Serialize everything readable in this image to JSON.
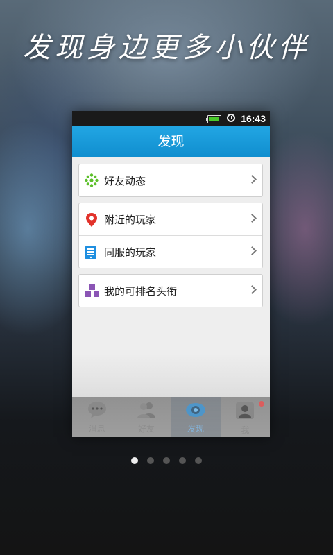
{
  "headline": "发现身边更多小伙伴",
  "status_bar": {
    "time": "16:43"
  },
  "title": "发现",
  "menu": {
    "group1": [
      {
        "label": "好友动态",
        "icon": "friends-activity-icon",
        "icon_color": "#5cbf2a"
      }
    ],
    "group2": [
      {
        "label": "附近的玩家",
        "icon": "location-pin-icon",
        "icon_color": "#e2322b"
      },
      {
        "label": "同服的玩家",
        "icon": "server-icon",
        "icon_color": "#1f8fe0"
      }
    ],
    "group3": [
      {
        "label": "我的可排名头衔",
        "icon": "rank-blocks-icon",
        "icon_color": "#8b55b5"
      }
    ]
  },
  "tabbar": {
    "tabs": [
      {
        "label": "消息",
        "icon": "chat-bubble-icon"
      },
      {
        "label": "好友",
        "icon": "contacts-icon"
      },
      {
        "label": "发现",
        "icon": "discover-eye-icon",
        "active": true
      },
      {
        "label": "我",
        "icon": "profile-icon",
        "badge": true
      }
    ]
  },
  "pager": {
    "total": 5,
    "active_index": 1
  },
  "colors": {
    "accent": "#1a9ad8",
    "background_dark": "#141414"
  }
}
